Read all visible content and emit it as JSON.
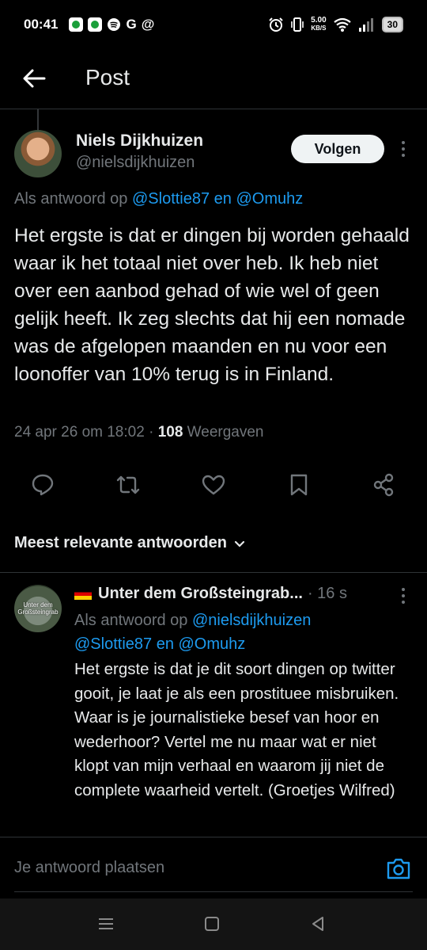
{
  "status": {
    "time": "00:41",
    "glyph_g": "G",
    "glyph_at": "@",
    "speed_value": "5.00",
    "speed_unit": "KB/S",
    "battery": "30",
    "icons": [
      "shield-app-icon",
      "shield-app-icon",
      "spotify-icon",
      "google-icon",
      "at-icon",
      "alarm-icon",
      "vibrate-icon",
      "wifi-icon",
      "signal-icon",
      "battery-icon"
    ]
  },
  "header": {
    "title": "Post",
    "back_icon": "arrow-left-icon"
  },
  "post": {
    "author_name": "Niels Dijkhuizen",
    "author_handle": "@nielsdijkhuizen",
    "follow_label": "Volgen",
    "reply_prefix": "Als antwoord op ",
    "reply_mention_1": "@Slottie87",
    "reply_join": " en ",
    "reply_mention_2": "@Omuhz",
    "text": "Het ergste is dat er dingen bij worden gehaald waar ik het totaal niet over heb. Ik heb niet over een aanbod gehad of wie wel of geen gelijk heeft. Ik zeg slechts dat hij een nomade was de afgelopen maanden en nu voor een loonoffer van 10% terug is in Finland.",
    "timestamp": "24 apr 26 om 18:02",
    "separator": " · ",
    "views_count": "108",
    "views_label": " Weergaven"
  },
  "actions": [
    "reply-icon",
    "repost-icon",
    "like-icon",
    "bookmark-icon",
    "share-icon"
  ],
  "sort": {
    "label": "Meest relevante antwoorden"
  },
  "reply": {
    "avatar_text": "Unter dem Großsteingrab",
    "name": "Unter dem Großsteingrab...",
    "time": "· 16 s",
    "reply_prefix": "Als antwoord op ",
    "mention_1": "@nielsdijkhuizen",
    "mention_2": "@Slottie87",
    "join": " en ",
    "mention_3": "@Omuhz",
    "text": "Het ergste is dat je dit soort dingen op twitter gooit, je laat je als een prostituee misbruiken. Waar is je journalistieke besef van hoor en wederhoor? Vertel me nu maar wat  er niet klopt van mijn verhaal en waarom jij niet de complete waarheid vertelt. (Groetjes Wilfred)"
  },
  "composer": {
    "placeholder": "Je antwoord plaatsen"
  },
  "colors": {
    "background": "#000000",
    "text": "#e7e9ea",
    "muted": "#71767b",
    "accent": "#1d9bf0",
    "divider": "#2f3336"
  }
}
